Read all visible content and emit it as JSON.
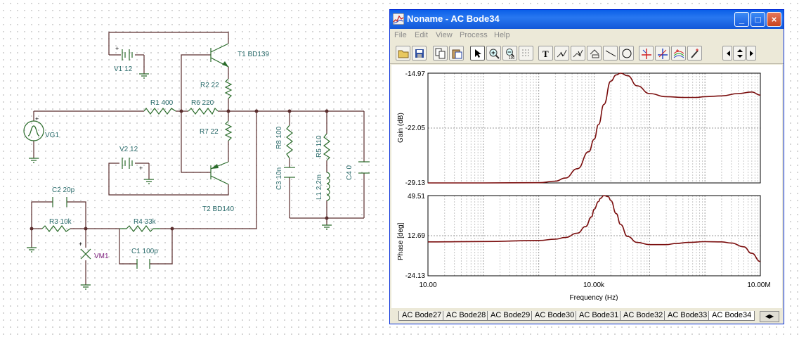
{
  "schematic": {
    "components": {
      "v1": "V1 12",
      "t1": "T1 BD139",
      "r2": "R2 22",
      "r1": "R1 400",
      "r6": "R6 220",
      "vg1": "VG1",
      "r7": "R7 22",
      "r8": "R8 100",
      "r5": "R5 110",
      "c3": "C3 10n",
      "l1": "L1 2,2m",
      "c4": "C4 0",
      "v2": "V2 12",
      "t2": "T2 BD140",
      "c2": "C2 20p",
      "r3": "R3 10k",
      "r4": "R4 33k",
      "c1": "C1 100p",
      "vm1": "VM1"
    },
    "colors": {
      "wire": "#5a2d2d",
      "part": "#2a6b2a",
      "label": "#2a6b6b",
      "meter": "#7a1a7a"
    }
  },
  "window": {
    "title": "Noname - AC Bode34",
    "controls": {
      "minimize": "_",
      "maximize": "□",
      "close": "×"
    },
    "menu": [
      "File",
      "Edit",
      "View",
      "Process",
      "Help"
    ],
    "toolbar_icons": [
      "open-icon",
      "save-icon",
      "copy-icon",
      "paste-icon",
      "pointer-icon",
      "zoom-in-icon",
      "zoom-100-icon",
      "grid-icon",
      "text-icon",
      "cursor-a-icon",
      "cursor-b-icon",
      "marker-icon",
      "line-icon",
      "circle-icon",
      "cursor-red-icon",
      "cursor-blue-icon",
      "curves-icon",
      "pen-icon",
      "nav-left-icon",
      "nav-updown-icon",
      "nav-right-icon"
    ],
    "zoom_label": "100"
  },
  "chart_data": {
    "type": "line",
    "x_axis": {
      "label": "Frequency (Hz)",
      "scale": "log",
      "range": [
        10,
        10000000
      ],
      "ticks": [
        "10.00",
        "10.00k",
        "10.00M"
      ]
    },
    "gain": {
      "ylabel": "Gain (dB)",
      "ylim": [
        -29.13,
        -14.97
      ],
      "ticks": [
        "-14.97",
        "-22.05",
        "-29.13"
      ],
      "x": [
        10,
        100,
        1000,
        2000,
        3000,
        5000,
        8000,
        10000,
        12000,
        15000,
        20000,
        25000,
        30000,
        40000,
        60000,
        100000,
        200000,
        400000,
        700000,
        1000000,
        2000000,
        4000000,
        7000000,
        10000000
      ],
      "y": [
        -29.13,
        -29.13,
        -29.1,
        -28.9,
        -28.5,
        -27.3,
        -25.1,
        -23.5,
        -21.6,
        -19.0,
        -16.0,
        -15.2,
        -14.97,
        -15.3,
        -16.6,
        -17.6,
        -18.0,
        -18.1,
        -18.1,
        -18.0,
        -17.9,
        -17.6,
        -17.4,
        -17.8
      ],
      "color": "#7a0d0d"
    },
    "phase": {
      "ylabel": "Phase [deg]",
      "ylim": [
        -24.13,
        49.51
      ],
      "ticks": [
        "49.51",
        "12.69",
        "-24.13"
      ],
      "x": [
        10,
        100,
        1000,
        2000,
        3000,
        5000,
        7000,
        9000,
        10000,
        12000,
        13000,
        15000,
        18000,
        20000,
        25000,
        30000,
        40000,
        60000,
        100000,
        200000,
        300000,
        500000,
        1000000,
        2000000,
        3000000,
        5000000,
        7000000,
        10000000
      ],
      "y": [
        7.0,
        7.3,
        8.3,
        9.5,
        11.0,
        15.0,
        21.0,
        30.0,
        37.0,
        44.0,
        47.0,
        49.5,
        48.5,
        45.0,
        33.0,
        23.0,
        12.0,
        6.5,
        4.5,
        4.5,
        5.5,
        6.5,
        7.2,
        7.0,
        6.0,
        2.5,
        -3.5,
        -11.0,
        -24.13
      ],
      "color": "#7a0d0d"
    },
    "grid": true
  },
  "tabs": [
    "AC Bode27",
    "AC Bode28",
    "AC Bode29",
    "AC Bode30",
    "AC Bode31",
    "AC Bode32",
    "AC Bode33",
    "AC Bode34"
  ],
  "active_tab": 7
}
